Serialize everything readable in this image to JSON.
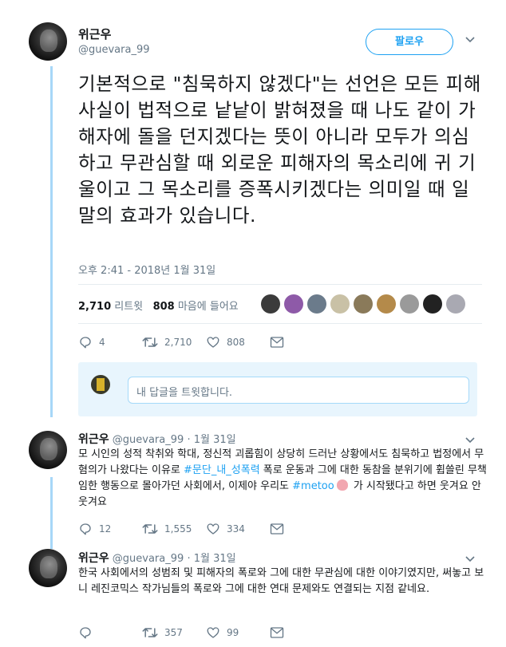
{
  "tweet": {
    "author_name": "위근우",
    "author_handle": "@guevara_99",
    "follow_label": "팔로우",
    "body": "기본적으로 \"침묵하지 않겠다\"는 선언은 모든 피해 사실이 법적으로 낱낱이 밝혀졌을 때 나도 같이 가해자에 돌을 던지겠다는 뜻이 아니라 모두가 의심하고 무관심할 때 외로운 피해자의 목소리에 귀 기울이고 그 목소리를 증폭시키겠다는 의미일 때 일말의 효과가 있습니다.",
    "timestamp": "오후 2:41 - 2018년 1월 31일",
    "retweet_count": "2,710",
    "retweet_label": "리트윗",
    "like_count": "808",
    "like_label": "마음에 들어요",
    "actions": {
      "reply": "4",
      "retweet": "2,710",
      "like": "808"
    }
  },
  "likers_colors": [
    "#3b3b3b",
    "#8e5aa8",
    "#6b7b8b",
    "#c9c1a6",
    "#8a7a5a",
    "#b48a4a",
    "#9a9a9a",
    "#222222",
    "#a9a9b2"
  ],
  "reply_box": {
    "placeholder": "내 답글을 트윗합니다."
  },
  "replies": [
    {
      "name": "위근우",
      "handle": "@guevara_99",
      "date": "· 1월 31일",
      "text_before": "모 시인의 성적 착취와 학대, 정신적 괴롭힘이 상당히 드러난 상황에서도 침묵하고 법정에서 무혐의가 나왔다는 이유로 ",
      "hashtag1": "#문단_내_성폭력",
      "text_middle": " 폭로 운동과 그에 대한 동참을 분위기에 휩쓸린 무책임한 행동으로 몰아가던 사회에서, 이제야 우리도 ",
      "hashtag2": "#metoo",
      "text_after": " 가 시작됐다고 하면 웃겨요 안 웃겨요",
      "actions": {
        "reply": "12",
        "retweet": "1,555",
        "like": "334"
      }
    },
    {
      "name": "위근우",
      "handle": "@guevara_99",
      "date": "· 1월 31일",
      "text": "한국 사회에서의 성범죄 및 피해자의 폭로와 그에 대한 무관심에 대한 이야기였지만, 써놓고 보니 레진코믹스 작가님들의 폭로와 그에 대한 연대 문제와도 연결되는 지점 같네요.",
      "actions": {
        "reply": "",
        "retweet": "357",
        "like": "99"
      }
    }
  ]
}
